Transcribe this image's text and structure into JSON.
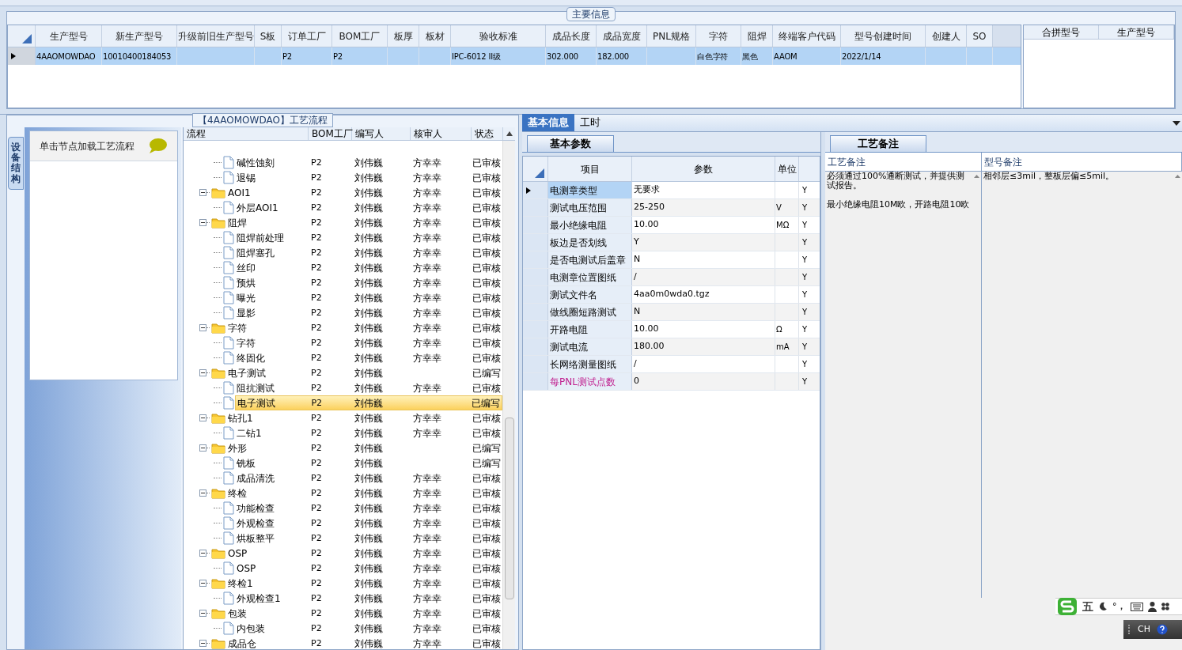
{
  "main_info": {
    "title": "主要信息",
    "selected": true,
    "columns": [
      {
        "label": "生产型号",
        "value": "4AAOMOWDAO"
      },
      {
        "label": "新生产型号",
        "value": "10010400184053"
      },
      {
        "label": "升级前旧生产型号"
      },
      {
        "label": "S板"
      },
      {
        "label": "订单工厂",
        "value": "P2"
      },
      {
        "label": "BOM工厂",
        "value": "P2"
      },
      {
        "label": "板厚"
      },
      {
        "label": "板材"
      },
      {
        "label": "验收标准",
        "value": "IPC-6012 II级"
      },
      {
        "label": "成品长度",
        "value": "302.000"
      },
      {
        "label": "成品宽度",
        "value": "182.000"
      },
      {
        "label": "PNL规格"
      },
      {
        "label": "字符",
        "value": "白色字符"
      },
      {
        "label": "阻焊",
        "value": "黑色"
      },
      {
        "label": "终端客户代码",
        "value": "AAOM"
      },
      {
        "label": "型号创建时间",
        "value": "2022/1/14"
      },
      {
        "label": "创建人"
      },
      {
        "label": "SO"
      }
    ]
  },
  "merge_table": {
    "columns": [
      "合拼型号",
      "生产型号"
    ]
  },
  "process_panel": {
    "title": "【4AAOMOWDAO】工艺流程"
  },
  "side_tab": {
    "label": "设备结构",
    "selected": true
  },
  "hint_card": {
    "text": "单击节点加载工艺流程"
  },
  "tree": {
    "columns": [
      "流程",
      "BOM工厂",
      "编写人",
      "核审人",
      "状态"
    ],
    "nodes": [
      {
        "kind": "hidden",
        "children": [
          {
            "kind": "leaf",
            "label": "碱性蚀刻",
            "bom": "P2",
            "writer": "刘伟巍",
            "reviewer": "方幸幸",
            "status": "已审核",
            "selected": false
          },
          {
            "kind": "leaf",
            "label": "退锡",
            "bom": "P2",
            "writer": "刘伟巍",
            "reviewer": "方幸幸",
            "status": "已审核",
            "selected": false
          }
        ]
      },
      {
        "kind": "folder",
        "label": "AOI1",
        "bom": "P2",
        "writer": "刘伟巍",
        "reviewer": "方幸幸",
        "status": "已审核",
        "selected": false,
        "expanded": true,
        "children": [
          {
            "kind": "leaf",
            "label": "外层AOI1",
            "bom": "P2",
            "writer": "刘伟巍",
            "reviewer": "方幸幸",
            "status": "已审核",
            "selected": false
          }
        ]
      },
      {
        "kind": "folder",
        "label": "阻焊",
        "bom": "P2",
        "writer": "刘伟巍",
        "reviewer": "方幸幸",
        "status": "已审核",
        "selected": false,
        "expanded": true,
        "children": [
          {
            "kind": "leaf",
            "label": "阻焊前处理",
            "bom": "P2",
            "writer": "刘伟巍",
            "reviewer": "方幸幸",
            "status": "已审核",
            "selected": false
          },
          {
            "kind": "leaf",
            "label": "阻焊塞孔",
            "bom": "P2",
            "writer": "刘伟巍",
            "reviewer": "方幸幸",
            "status": "已审核",
            "selected": false
          },
          {
            "kind": "leaf",
            "label": "丝印",
            "bom": "P2",
            "writer": "刘伟巍",
            "reviewer": "方幸幸",
            "status": "已审核",
            "selected": false
          },
          {
            "kind": "leaf",
            "label": "预烘",
            "bom": "P2",
            "writer": "刘伟巍",
            "reviewer": "方幸幸",
            "status": "已审核",
            "selected": false
          },
          {
            "kind": "leaf",
            "label": "曝光",
            "bom": "P2",
            "writer": "刘伟巍",
            "reviewer": "方幸幸",
            "status": "已审核",
            "selected": false
          },
          {
            "kind": "leaf",
            "label": "显影",
            "bom": "P2",
            "writer": "刘伟巍",
            "reviewer": "方幸幸",
            "status": "已审核",
            "selected": false
          }
        ]
      },
      {
        "kind": "folder",
        "label": "字符",
        "bom": "P2",
        "writer": "刘伟巍",
        "reviewer": "方幸幸",
        "status": "已审核",
        "selected": false,
        "expanded": true,
        "children": [
          {
            "kind": "leaf",
            "label": "字符",
            "bom": "P2",
            "writer": "刘伟巍",
            "reviewer": "方幸幸",
            "status": "已审核",
            "selected": false
          },
          {
            "kind": "leaf",
            "label": "终固化",
            "bom": "P2",
            "writer": "刘伟巍",
            "reviewer": "方幸幸",
            "status": "已审核",
            "selected": false
          }
        ]
      },
      {
        "kind": "folder",
        "label": "电子测试",
        "bom": "P2",
        "writer": "刘伟巍",
        "status": "已编写",
        "selected": false,
        "expanded": true,
        "children": [
          {
            "kind": "leaf",
            "label": "阻抗测试",
            "bom": "P2",
            "writer": "刘伟巍",
            "reviewer": "方幸幸",
            "status": "已审核",
            "selected": false
          },
          {
            "kind": "leaf",
            "label": "电子测试",
            "bom": "P2",
            "writer": "刘伟巍",
            "status": "已编写",
            "selected": true
          }
        ]
      },
      {
        "kind": "folder",
        "label": "钻孔1",
        "bom": "P2",
        "writer": "刘伟巍",
        "reviewer": "方幸幸",
        "status": "已审核",
        "selected": false,
        "expanded": true,
        "children": [
          {
            "kind": "leaf",
            "label": "二钻1",
            "bom": "P2",
            "writer": "刘伟巍",
            "reviewer": "方幸幸",
            "status": "已审核",
            "selected": false
          }
        ]
      },
      {
        "kind": "folder",
        "label": "外形",
        "bom": "P2",
        "writer": "刘伟巍",
        "status": "已编写",
        "selected": false,
        "expanded": true,
        "children": [
          {
            "kind": "leaf",
            "label": "铣板",
            "bom": "P2",
            "writer": "刘伟巍",
            "status": "已编写",
            "selected": false
          },
          {
            "kind": "leaf",
            "label": "成品清洗",
            "bom": "P2",
            "writer": "刘伟巍",
            "reviewer": "方幸幸",
            "status": "已审核",
            "selected": false
          }
        ]
      },
      {
        "kind": "folder",
        "label": "终检",
        "bom": "P2",
        "writer": "刘伟巍",
        "reviewer": "方幸幸",
        "status": "已审核",
        "selected": false,
        "expanded": true,
        "children": [
          {
            "kind": "leaf",
            "label": "功能检查",
            "bom": "P2",
            "writer": "刘伟巍",
            "reviewer": "方幸幸",
            "status": "已审核",
            "selected": false
          },
          {
            "kind": "leaf",
            "label": "外观检查",
            "bom": "P2",
            "writer": "刘伟巍",
            "reviewer": "方幸幸",
            "status": "已审核",
            "selected": false
          },
          {
            "kind": "leaf",
            "label": "烘板整平",
            "bom": "P2",
            "writer": "刘伟巍",
            "reviewer": "方幸幸",
            "status": "已审核",
            "selected": false
          }
        ]
      },
      {
        "kind": "folder",
        "label": "OSP",
        "bom": "P2",
        "writer": "刘伟巍",
        "reviewer": "方幸幸",
        "status": "已审核",
        "selected": false,
        "expanded": true,
        "children": [
          {
            "kind": "leaf",
            "label": "OSP",
            "bom": "P2",
            "writer": "刘伟巍",
            "reviewer": "方幸幸",
            "status": "已审核",
            "selected": false
          }
        ]
      },
      {
        "kind": "folder",
        "label": "终检1",
        "bom": "P2",
        "writer": "刘伟巍",
        "reviewer": "方幸幸",
        "status": "已审核",
        "selected": false,
        "expanded": true,
        "children": [
          {
            "kind": "leaf",
            "label": "外观检查1",
            "bom": "P2",
            "writer": "刘伟巍",
            "reviewer": "方幸幸",
            "status": "已审核",
            "selected": false
          }
        ]
      },
      {
        "kind": "folder",
        "label": "包装",
        "bom": "P2",
        "writer": "刘伟巍",
        "reviewer": "方幸幸",
        "status": "已审核",
        "selected": false,
        "expanded": true,
        "children": [
          {
            "kind": "leaf",
            "label": "内包装",
            "bom": "P2",
            "writer": "刘伟巍",
            "reviewer": "方幸幸",
            "status": "已审核",
            "selected": false
          }
        ]
      },
      {
        "kind": "folder",
        "label": "成品仓",
        "bom": "P2",
        "writer": "刘伟巍",
        "reviewer": "方幸幸",
        "status": "已审核",
        "selected": false,
        "expanded": true
      }
    ]
  },
  "detail_tabs": [
    {
      "label": "基本信息",
      "selected": true
    },
    {
      "label": "工时",
      "selected": false
    }
  ],
  "params": {
    "title": "基本参数",
    "columns": [
      "项目",
      "参数",
      "单位"
    ],
    "rows": [
      {
        "item": "电测章类型",
        "value": "无要求",
        "column_5": "Y",
        "selected": true,
        "flagged": false
      },
      {
        "item": "测试电压范围",
        "value": "25-250",
        "unit": "V",
        "column_5": "Y",
        "selected": false,
        "flagged": false
      },
      {
        "item": "最小绝缘电阻",
        "value": "10.00",
        "unit": "MΩ",
        "column_5": "Y",
        "selected": false,
        "flagged": false
      },
      {
        "item": "板边是否划线",
        "value": "Y",
        "column_5": "Y",
        "selected": false,
        "flagged": false
      },
      {
        "item": "是否电测试后盖章",
        "value": "N",
        "column_5": "Y",
        "selected": false,
        "flagged": false
      },
      {
        "item": "电测章位置图纸",
        "value": "/",
        "column_5": "Y",
        "selected": false,
        "flagged": false
      },
      {
        "item": "测试文件名",
        "value": "4aa0m0wda0.tgz",
        "column_5": "Y",
        "selected": false,
        "flagged": false
      },
      {
        "item": "做线圈短路测试",
        "value": "N",
        "column_5": "Y",
        "selected": false,
        "flagged": false
      },
      {
        "item": "开路电阻",
        "value": "10.00",
        "unit": "Ω",
        "column_5": "Y",
        "selected": false,
        "flagged": false
      },
      {
        "item": "测试电流",
        "value": "180.00",
        "unit": "mA",
        "column_5": "Y",
        "selected": false,
        "flagged": false
      },
      {
        "item": "长网络测量图纸",
        "value": "/",
        "column_5": "Y",
        "selected": false,
        "flagged": false
      },
      {
        "item": "每PNL测试点数",
        "value": "0",
        "column_5": "Y",
        "selected": false,
        "flagged": true
      }
    ]
  },
  "remarks": {
    "title": "工艺备注",
    "columns": [
      "工艺备注",
      "型号备注"
    ],
    "process_note": [
      "必须通过100%通断测试，并提供测试报告。",
      "最小绝缘电阻10M欧，开路电阻10欧"
    ],
    "model_note": "相邻层≤3mil，整板层偏≤5mil。"
  },
  "ime_bar": {
    "mode": "五",
    "punct": "°，",
    "language": "CH"
  }
}
